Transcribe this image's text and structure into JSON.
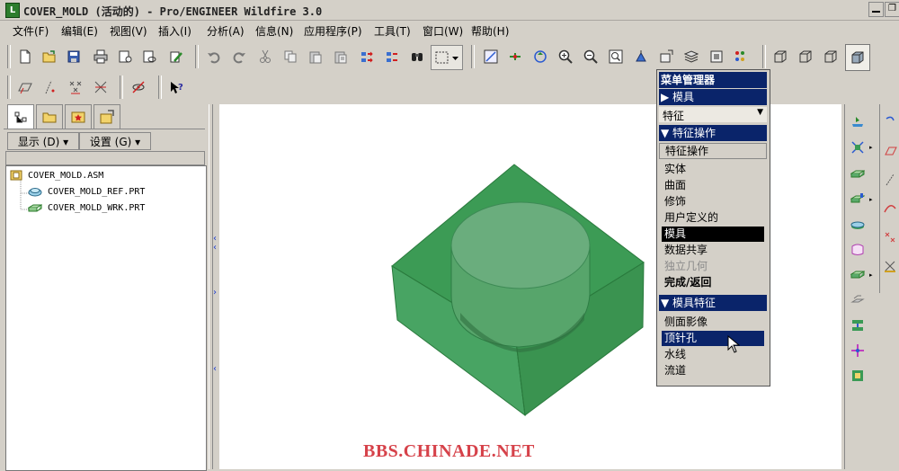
{
  "window": {
    "title": "COVER_MOLD (活动的) - Pro/ENGINEER Wildfire 3.0",
    "restore_glyph": "❐"
  },
  "menubar": {
    "items": [
      "文件(F)",
      "编辑(E)",
      "视图(V)",
      "插入(I)",
      "分析(A)",
      "信息(N)",
      "应用程序(P)",
      "工具(T)",
      "窗口(W)",
      "帮助(H)"
    ]
  },
  "left_panel": {
    "show_label": "显示 (D) ▾",
    "settings_label": "设置 (G) ▾",
    "tree": [
      "COVER_MOLD.ASM",
      "COVER_MOLD_REF.PRT",
      "COVER_MOLD_WRK.PRT"
    ]
  },
  "menu_manager": {
    "title": "菜单管理器",
    "mold_header": "▶ 模具",
    "feature_dropdown": "特征",
    "feature_ops_header": "▼ 特征操作",
    "feature_ops_title": "特征操作",
    "feature_ops_items": [
      "实体",
      "曲面",
      "修饰",
      "用户定义的",
      "模具",
      "数据共享",
      "独立几何",
      "完成/返回"
    ],
    "mold_feature_header": "▼ 模具特征",
    "mold_feature_items": [
      "侧面影像",
      "顶针孔",
      "水线",
      "流道"
    ]
  },
  "watermark": "BBS.CHINADE.NET",
  "colors": {
    "selection_blue": "#0a246a",
    "model_green": "#3d9a55",
    "watermark_red": "#d6424a"
  }
}
